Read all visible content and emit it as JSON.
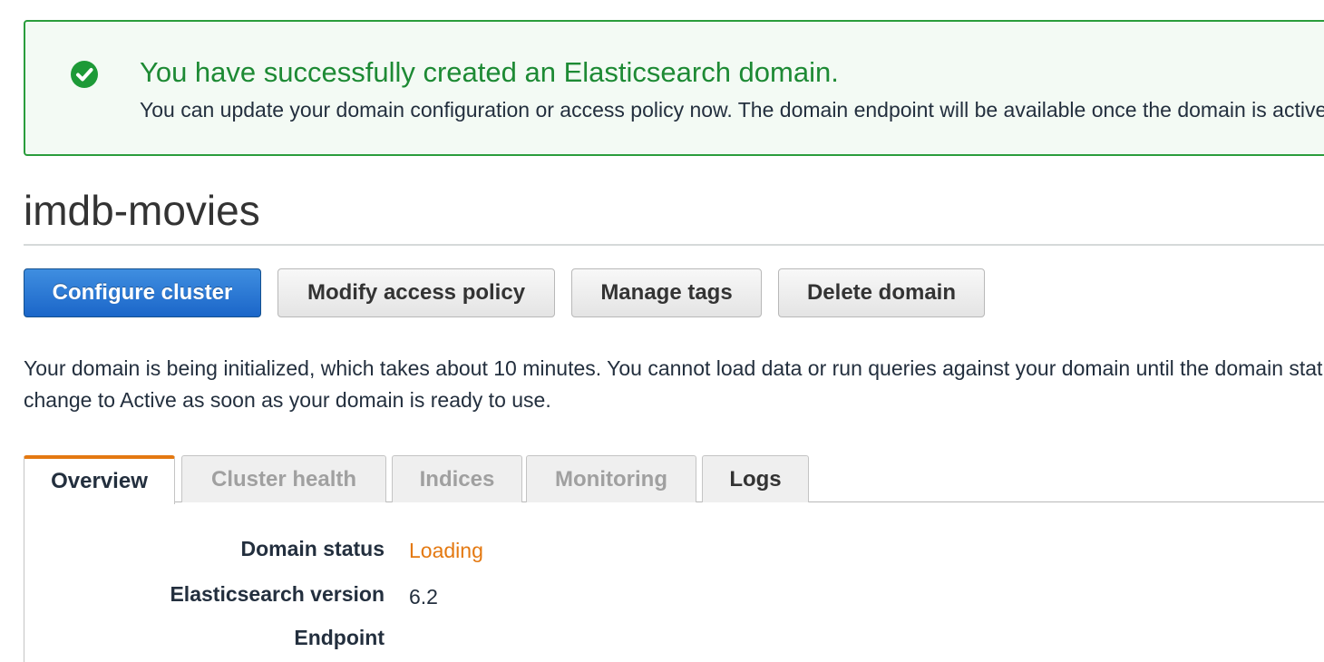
{
  "banner": {
    "icon": "check-circle-icon",
    "title": "You have successfully created an Elasticsearch domain.",
    "message": "You can update your domain configuration or access policy now. The domain endpoint will be available once the domain is active."
  },
  "page": {
    "title": "imdb-movies"
  },
  "actions": {
    "configure": "Configure cluster",
    "modify": "Modify access policy",
    "tags": "Manage tags",
    "delete": "Delete domain"
  },
  "info": {
    "line1": "Your domain is being initialized, which takes about 10 minutes. You cannot load data or run queries against your domain until the domain status changes. The status will",
    "line2": "change to Active as soon as your domain is ready to use."
  },
  "tabs": [
    {
      "label": "Overview",
      "active": true
    },
    {
      "label": "Cluster health",
      "active": false
    },
    {
      "label": "Indices",
      "active": false
    },
    {
      "label": "Monitoring",
      "active": false
    },
    {
      "label": "Logs",
      "active": false
    }
  ],
  "overview": {
    "status_label": "Domain status",
    "status_value": "Loading",
    "version_label": "Elasticsearch version",
    "version_value": "6.2",
    "endpoint_label": "Endpoint"
  },
  "colors": {
    "success": "#1d8a34",
    "primary": "#1b66c9",
    "loading": "#e47911",
    "tab_accent": "#e47911"
  }
}
